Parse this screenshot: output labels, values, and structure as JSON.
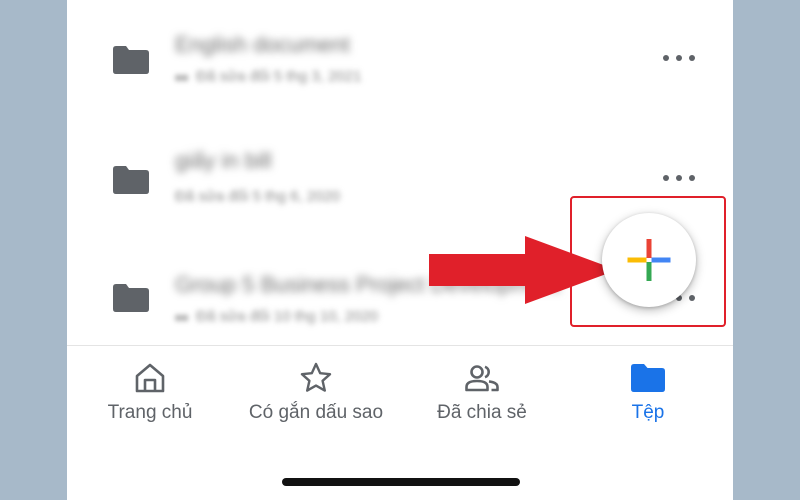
{
  "files": [
    {
      "name": "English document",
      "meta": "Đã sửa đổi 5 thg 3, 2021",
      "shared": true
    },
    {
      "name": "giấy in bill",
      "meta": "Đã sửa đổi 5 thg 6, 2020",
      "shared": false
    },
    {
      "name": "Group 5 Business Project Development",
      "meta": "Đã sửa đổi 10 thg 10, 2020",
      "shared": true
    }
  ],
  "bottom_nav": {
    "items": [
      {
        "label": "Trang chủ",
        "icon": "home-icon",
        "active": false
      },
      {
        "label": "Có gắn dấu sao",
        "icon": "star-icon",
        "active": false
      },
      {
        "label": "Đã chia sẻ",
        "icon": "people-icon",
        "active": false
      },
      {
        "label": "Tệp",
        "icon": "folder-icon",
        "active": true
      }
    ]
  },
  "fab": {
    "icon": "plus-icon"
  },
  "colors": {
    "folder": "#5f6368",
    "nav_inactive": "#5f6368",
    "nav_active": "#1a73e8",
    "annotation_red": "#e0202a",
    "plus_red": "#ea4335",
    "plus_blue": "#4285f4",
    "plus_yellow": "#fbbc04",
    "plus_green": "#34a853"
  }
}
